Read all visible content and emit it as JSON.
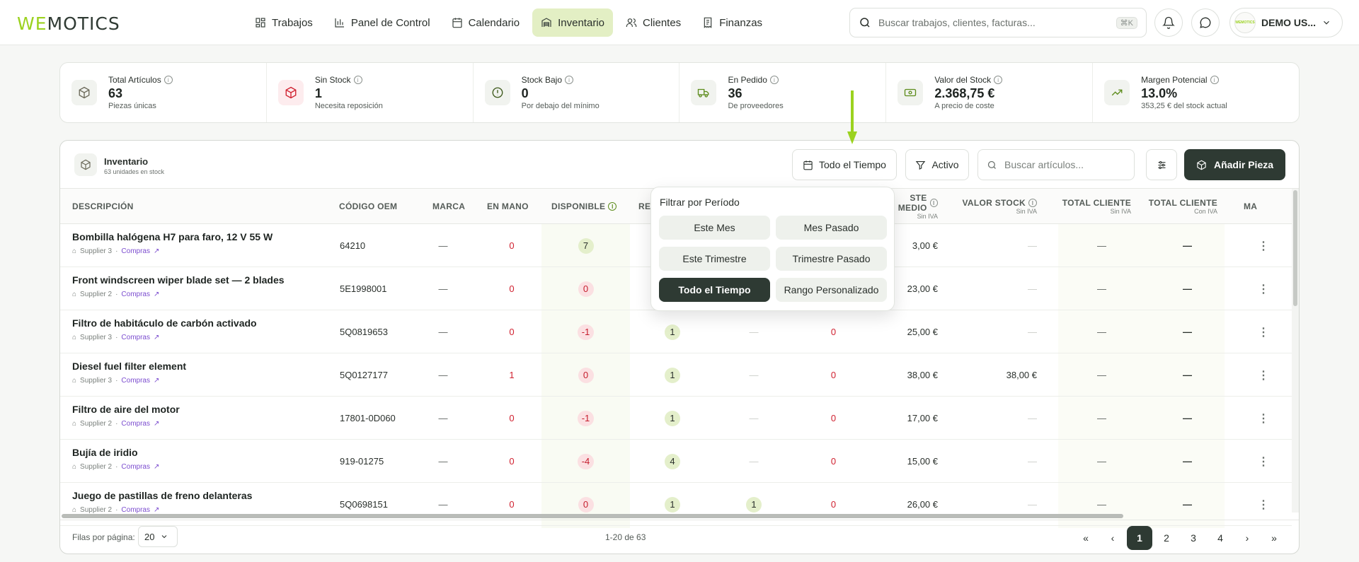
{
  "brand": {
    "logo_we": "WE",
    "logo_rest": "MOTICS",
    "accent": "#9bd21f",
    "dark": "#2e3a33"
  },
  "nav": [
    {
      "label": "Trabajos",
      "icon": "grid-icon"
    },
    {
      "label": "Panel de Control",
      "icon": "bar-chart-icon"
    },
    {
      "label": "Calendario",
      "icon": "calendar-icon"
    },
    {
      "label": "Inventario",
      "icon": "warehouse-icon",
      "active": true
    },
    {
      "label": "Clientes",
      "icon": "users-icon"
    },
    {
      "label": "Finanzas",
      "icon": "receipt-icon"
    }
  ],
  "search": {
    "placeholder": "Buscar trabajos, clientes, facturas...",
    "shortcut": "⌘K"
  },
  "user": {
    "name": "DEMO US...",
    "avatar_text": "WEMOTICS"
  },
  "stats": [
    {
      "label": "Total Artículos",
      "value": "63",
      "sub": "Piezas únicas",
      "icon": "box-icon"
    },
    {
      "label": "Sin Stock",
      "value": "1",
      "sub": "Necesita reposición",
      "icon": "box-alert-icon"
    },
    {
      "label": "Stock Bajo",
      "value": "0",
      "sub": "Por debajo del mínimo",
      "icon": "alert-circle-icon"
    },
    {
      "label": "En Pedido",
      "value": "36",
      "sub": "De proveedores",
      "icon": "truck-icon"
    },
    {
      "label": "Valor del Stock",
      "value": "2.368,75 €",
      "sub": "A precio de coste",
      "icon": "banknote-icon"
    },
    {
      "label": "Margen Potencial",
      "value": "13.0%",
      "sub": "353,25 € del stock actual",
      "icon": "trending-up-icon"
    }
  ],
  "panel": {
    "title": "Inventario",
    "subtitle": "63 unidades en stock",
    "period_button": "Todo el Tiempo",
    "status_button": "Activo",
    "search_placeholder": "Buscar artículos...",
    "add_button": "Añadir Pieza"
  },
  "columns": {
    "desc": "Descripción",
    "oem": "Código OEM",
    "brand": "Marca",
    "onhand": "En Mano",
    "available": "Disponible",
    "reserved": "Re",
    "avgcost": "ste Medio",
    "avgcost_sub": "Sin IVA",
    "stockval": "Valor Stock",
    "stockval_sub": "Sin IVA",
    "totclient": "Total Cliente",
    "totclient_sub": "Sin IVA",
    "totclient2": "Total Cliente",
    "totclient2_sub": "Con IVA",
    "more": "Ma"
  },
  "rows": [
    {
      "name": "Bombilla halógena H7 para faro, 12 V 55 W",
      "supplier": "Supplier 3",
      "link": "Compras",
      "oem": "64210",
      "brand": "—",
      "onhand": "0",
      "available": "7",
      "avail_neg": false,
      "reserved": "",
      "col8": "",
      "col9": "",
      "avgcost": "3,00 €",
      "stockval": "—",
      "tc": "—",
      "tc2": "—"
    },
    {
      "name": "Front windscreen wiper blade set — 2 blades",
      "supplier": "Supplier 2",
      "link": "Compras",
      "oem": "5E1998001",
      "brand": "—",
      "onhand": "0",
      "available": "0",
      "avail_neg": true,
      "reserved": "",
      "col8": "",
      "col9": "",
      "avgcost": "23,00 €",
      "stockval": "—",
      "tc": "—",
      "tc2": "—"
    },
    {
      "name": "Filtro de habitáculo de carbón activado",
      "supplier": "Supplier 3",
      "link": "Compras",
      "oem": "5Q0819653",
      "brand": "—",
      "onhand": "0",
      "available": "-1",
      "avail_neg": true,
      "reserved": "1",
      "col8": "—",
      "col9": "0",
      "avgcost": "25,00 €",
      "stockval": "—",
      "tc": "—",
      "tc2": "—"
    },
    {
      "name": "Diesel fuel filter element",
      "supplier": "Supplier 3",
      "link": "Compras",
      "oem": "5Q0127177",
      "brand": "—",
      "onhand": "1",
      "available": "0",
      "avail_neg": true,
      "reserved": "1",
      "col8": "—",
      "col9": "0",
      "avgcost": "38,00 €",
      "stockval": "38,00 €",
      "tc": "—",
      "tc2": "—"
    },
    {
      "name": "Filtro de aire del motor",
      "supplier": "Supplier 2",
      "link": "Compras",
      "oem": "17801-0D060",
      "brand": "—",
      "onhand": "0",
      "available": "-1",
      "avail_neg": true,
      "reserved": "1",
      "col8": "—",
      "col9": "0",
      "avgcost": "17,00 €",
      "stockval": "—",
      "tc": "—",
      "tc2": "—"
    },
    {
      "name": "Bujía de iridio",
      "supplier": "Supplier 2",
      "link": "Compras",
      "oem": "919-01275",
      "brand": "—",
      "onhand": "0",
      "available": "-4",
      "avail_neg": true,
      "reserved": "4",
      "col8": "—",
      "col9": "0",
      "avgcost": "15,00 €",
      "stockval": "—",
      "tc": "—",
      "tc2": "—"
    },
    {
      "name": "Juego de pastillas de freno delanteras",
      "supplier": "Supplier 2",
      "link": "Compras",
      "oem": "5Q0698151",
      "brand": "—",
      "onhand": "0",
      "available": "0",
      "avail_neg": true,
      "reserved": "1",
      "col8": "1",
      "col9": "0",
      "avgcost": "26,00 €",
      "stockval": "—",
      "tc": "—",
      "tc2": "—"
    }
  ],
  "period_popup": {
    "title": "Filtrar por Período",
    "options": [
      "Este Mes",
      "Mes Pasado",
      "Este Trimestre",
      "Trimestre Pasado",
      "Todo el Tiempo",
      "Rango Personalizado"
    ],
    "selected": "Todo el Tiempo"
  },
  "footer": {
    "rows_label": "Filas por página:",
    "rows_value": "20",
    "range": "1-20 de 63",
    "pages": [
      "1",
      "2",
      "3",
      "4"
    ],
    "current_page": "1"
  }
}
